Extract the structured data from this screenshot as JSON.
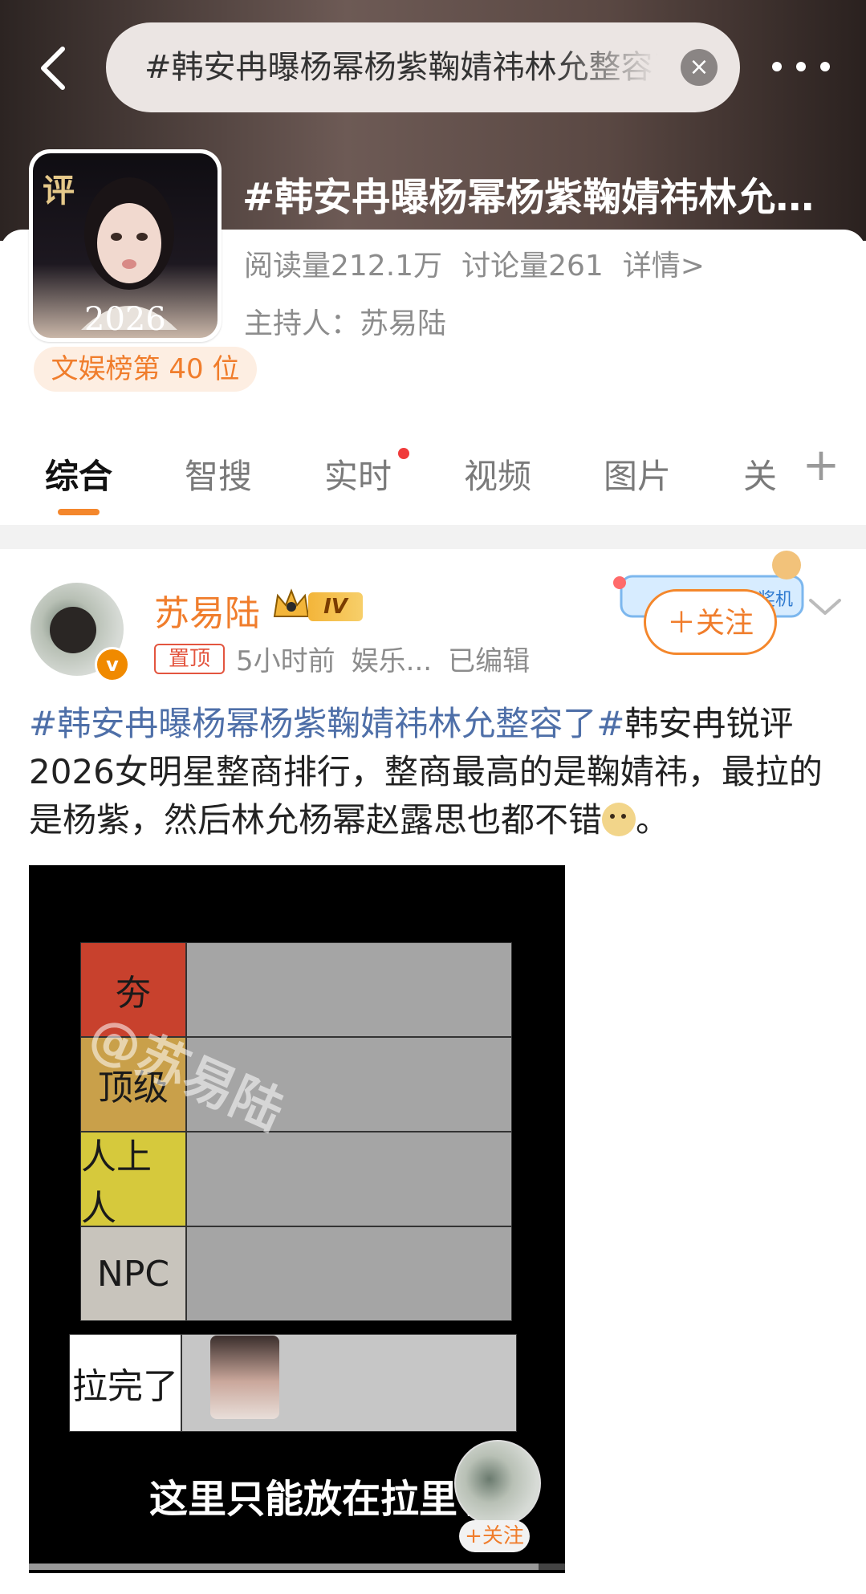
{
  "header": {
    "search_query": "#韩安冉曝杨幂杨紫鞠婧祎林允整容了",
    "clear_symbol": "×",
    "topic_title": "#韩安冉曝杨幂杨紫鞠婧祎林允整容了#"
  },
  "topic": {
    "cover_char": "评",
    "cover_year": "2026",
    "rank": "文娱榜第 40 位",
    "reads": "阅读量212.1万",
    "discussions": "讨论量261",
    "details": "详情>",
    "host": "主持人：苏易陆"
  },
  "tabs": [
    {
      "label": "综合",
      "active": true
    },
    {
      "label": "智搜"
    },
    {
      "label": "实时",
      "dot": true
    },
    {
      "label": "视频"
    },
    {
      "label": "图片"
    },
    {
      "label": "关"
    }
  ],
  "tab_plus": "+",
  "post": {
    "username": "苏易陆",
    "level": "IV",
    "verified_symbol": "v",
    "pin_tag": "置顶",
    "time": "5小时前",
    "source": "娱乐...",
    "edited": "已编辑",
    "follow_label": "＋关注",
    "follow_deco_text": "抽奖机",
    "text_hashtag": "#韩安冉曝杨幂杨紫鞠婧祎林允整容了#",
    "text_body": "韩安冉锐评2026女明星整商排行，整商最高的是鞠婧祎，最拉的是杨紫，然后林允杨幂赵露思也都不错",
    "text_end": "。"
  },
  "image": {
    "watermark": "@苏易陆",
    "tiers": [
      {
        "label": "夯",
        "color": "#c8412d"
      },
      {
        "label": "顶级",
        "color": "#c9a04a"
      },
      {
        "label": "人上人",
        "color": "#d6c93c"
      },
      {
        "label": "NPC",
        "color": "#c8c4bc"
      },
      {
        "label": "拉完了",
        "color": "#ffffff"
      }
    ],
    "caption": "这里只能放在拉里了",
    "mini_follow": "+关注",
    "progress": 0.95
  },
  "colors": {
    "accent": "#f4872c",
    "hashtag": "#4e6fa8"
  },
  "icons": [
    "back-arrow-icon",
    "close-icon",
    "more-dots-icon",
    "plus-icon",
    "crown-icon",
    "chevron-down-icon",
    "doge-emoji-icon"
  ]
}
